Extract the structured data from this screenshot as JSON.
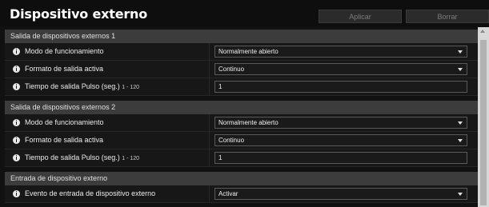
{
  "page": {
    "title": "Dispositivo externo",
    "apply_label": "Aplicar",
    "delete_label": "Borrar"
  },
  "sections": [
    {
      "title": "Salida de dispositivos externos 1",
      "mode_label": "Modo de funcionamiento",
      "mode_value": "Normalmente abierto",
      "format_label": "Formato de salida activa",
      "format_value": "Continuo",
      "pulse_label": "Tiempo de salida Pulso (seg.)",
      "pulse_range": "1 - 120",
      "pulse_value": "1"
    },
    {
      "title": "Salida de dispositivos externos 2",
      "mode_label": "Modo de funcionamiento",
      "mode_value": "Normalmente abierto",
      "format_label": "Formato de salida activa",
      "format_value": "Continuo",
      "pulse_label": "Tiempo de salida Pulso (seg.)",
      "pulse_range": "1 - 120",
      "pulse_value": "1"
    },
    {
      "title": "Entrada de dispositivo externo",
      "event_label": "Evento de entrada de dispositivo externo",
      "event_value": "Activar"
    }
  ],
  "icons": {
    "info": "info-icon",
    "dropdown": "chevron-down-icon",
    "scroll_up": "scroll-up-arrow-icon"
  },
  "colors": {
    "background": "#111111",
    "section_header": "#3c3c3c",
    "row": "#171717",
    "scrollbar": "#d8d8d8"
  }
}
